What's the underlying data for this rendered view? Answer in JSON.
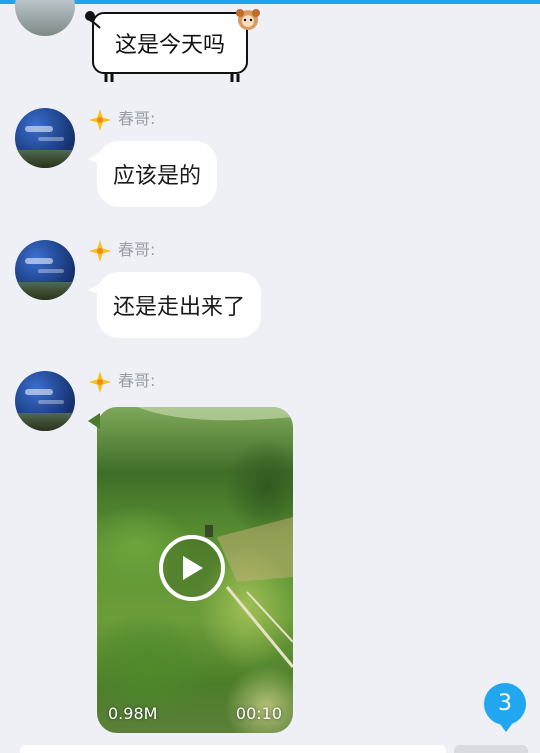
{
  "colors": {
    "accent": "#1fa3ee",
    "background": "#eef0f6",
    "bubble": "#ffffff",
    "unread_badge": "#21a6f0"
  },
  "messages": [
    {
      "type": "text",
      "from": "self",
      "text": "这是今天吗"
    },
    {
      "type": "text",
      "from": "other",
      "sender": "春哥:",
      "text": "应该是的"
    },
    {
      "type": "text",
      "from": "other",
      "sender": "春哥:",
      "text": "还是走出来了"
    },
    {
      "type": "video",
      "from": "other",
      "sender": "春哥:",
      "size": "0.98M",
      "duration": "00:10"
    }
  ],
  "unread_count": "3"
}
